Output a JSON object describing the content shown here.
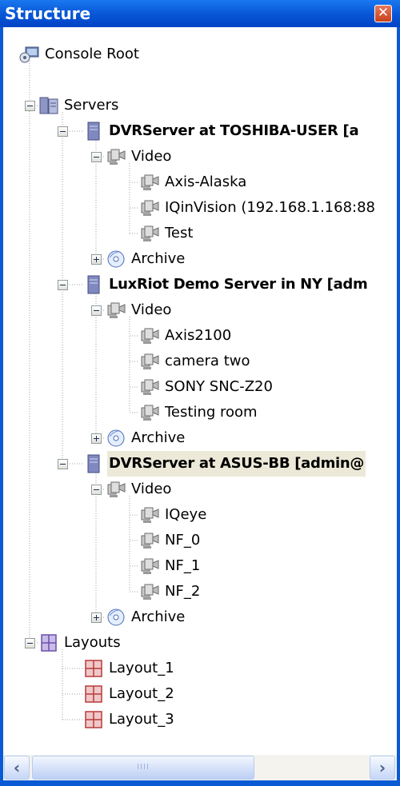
{
  "panel": {
    "title": "Structure",
    "close_glyph": "✕"
  },
  "tree": {
    "root": {
      "label": "Console Root",
      "icon": "console-root-icon"
    },
    "servers": {
      "label": "Servers",
      "icon": "servers-icon",
      "expanded": true,
      "items": [
        {
          "label": "DVRServer at TOSHIBA-USER [a",
          "icon": "server-icon",
          "expanded": true,
          "video": {
            "label": "Video",
            "icon": "video-cameras-icon",
            "expanded": true,
            "cameras": [
              "Axis-Alaska",
              "IQinVision (192.168.1.168:88",
              "Test"
            ]
          },
          "archive": {
            "label": "Archive",
            "icon": "archive-disc-icon",
            "expanded": false
          }
        },
        {
          "label": "LuxRiot Demo Server in NY [adm",
          "icon": "server-icon",
          "expanded": true,
          "video": {
            "label": "Video",
            "icon": "video-cameras-icon",
            "expanded": true,
            "cameras": [
              "Axis2100",
              "camera two",
              "SONY SNC-Z20",
              "Testing room"
            ]
          },
          "archive": {
            "label": "Archive",
            "icon": "archive-disc-icon",
            "expanded": false
          }
        },
        {
          "label": "DVRServer at ASUS-BB [admin@",
          "icon": "server-icon",
          "expanded": true,
          "selected": true,
          "video": {
            "label": "Video",
            "icon": "video-cameras-icon",
            "expanded": true,
            "cameras": [
              "IQeye",
              "NF_0",
              "NF_1",
              "NF_2"
            ]
          },
          "archive": {
            "label": "Archive",
            "icon": "archive-disc-icon",
            "expanded": false
          }
        }
      ]
    },
    "layouts": {
      "label": "Layouts",
      "icon": "layouts-icon",
      "expanded": true,
      "items": [
        "Layout_1",
        "Layout_2",
        "Layout_3"
      ]
    }
  },
  "scrollbar": {
    "left_glyph": "‹",
    "right_glyph": "›",
    "grip": "IIII"
  },
  "colors": {
    "titlebar": "#0858d8",
    "selection_bg": "#ece9d8",
    "tree_lines": "#a0a0a0"
  }
}
